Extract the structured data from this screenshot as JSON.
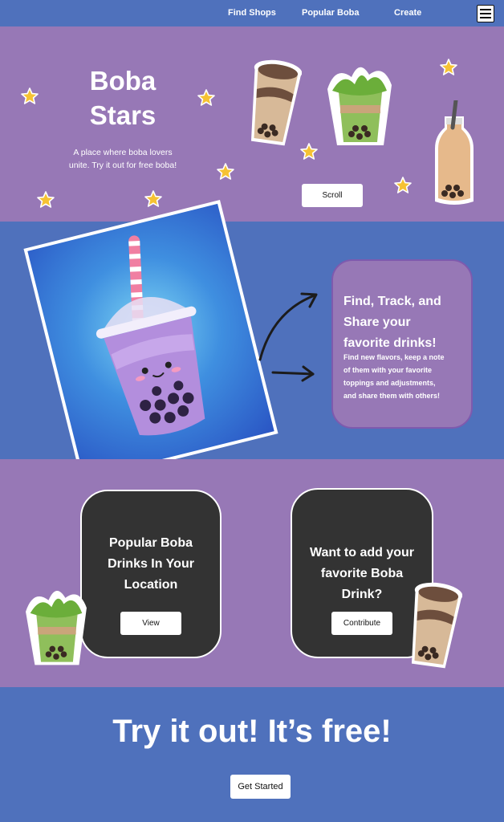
{
  "nav": {
    "links": [
      "Find Shops",
      "Popular Boba",
      "Create"
    ],
    "menu_icon": "hamburger-icon"
  },
  "hero": {
    "title_line1": "Boba",
    "title_line2": "Stars",
    "subtitle_line1": "A place where boba lovers",
    "subtitle_line2": "unite. Try it out for free boba!",
    "scroll_label": "Scroll"
  },
  "feature": {
    "heading_lines": [
      "Find, Track, and",
      "Share your",
      "favorite drinks!"
    ],
    "body_lines": [
      "Find new flavors, keep a note",
      "of them with your favorite",
      "toppings and adjustments,",
      "and share them with others!"
    ]
  },
  "cards": {
    "popular_lines": [
      "Popular Boba",
      "Drinks In Your",
      "Location"
    ],
    "popular_button": "View",
    "contribute_lines": [
      "Want to add your",
      "favorite Boba",
      "Drink?"
    ],
    "contribute_button": "Contribute"
  },
  "cta": {
    "title": "Try it out! It’s free!",
    "button": "Get Started"
  },
  "colors": {
    "blue": "#4F71BC",
    "purple": "#9778B6",
    "dark": "#333333",
    "star": "#F6C233"
  }
}
